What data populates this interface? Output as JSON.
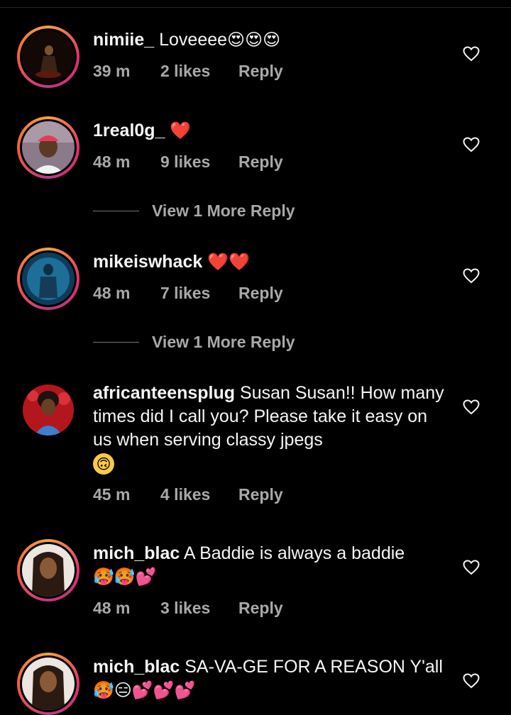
{
  "comments": [
    {
      "username": "nimiie_",
      "text": "Loveeee",
      "emoji": "😍😍😍",
      "time": "39 m",
      "likes": "2 likes",
      "reply": "Reply"
    },
    {
      "username": "1real0g_",
      "text": "",
      "emoji": "❤️",
      "time": "48 m",
      "likes": "9 likes",
      "reply": "Reply",
      "view_more": "View 1 More Reply"
    },
    {
      "username": "mikeiswhack",
      "text": "",
      "emoji": "❤️❤️",
      "time": "48 m",
      "likes": "7 likes",
      "reply": "Reply",
      "view_more": "View 1 More Reply"
    },
    {
      "username": "africanteensplug",
      "text": "Susan Susan!! How many times did I call you? Please take it easy on us when serving classy jpegs",
      "emoji": "🙃",
      "time": "45 m",
      "likes": "4 likes",
      "reply": "Reply"
    },
    {
      "username": "mich_blac",
      "text": "A Baddie is always a baddie",
      "emoji": "🥵🥵💕",
      "time": "48 m",
      "likes": "3 likes",
      "reply": "Reply"
    },
    {
      "username": "mich_blac",
      "text": "SA-VA-GE FOR A REASON Y'all",
      "emoji": "🥵😑💕💕💕",
      "time": "",
      "likes": "",
      "reply": ""
    }
  ]
}
